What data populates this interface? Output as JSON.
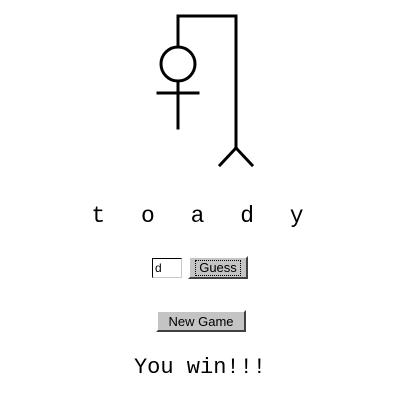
{
  "game": {
    "word_letters": [
      "t",
      "o",
      "a",
      "d",
      "y"
    ],
    "word_display": "t o a d y",
    "guess_value": "d",
    "guess_button_label": "Guess",
    "new_game_label": "New Game",
    "result_text": "You win!!!",
    "wrong_guesses_shown": 2
  },
  "colors": {
    "background": "#ffffff",
    "ink": "#000000",
    "button_face": "#c4c4c4"
  }
}
